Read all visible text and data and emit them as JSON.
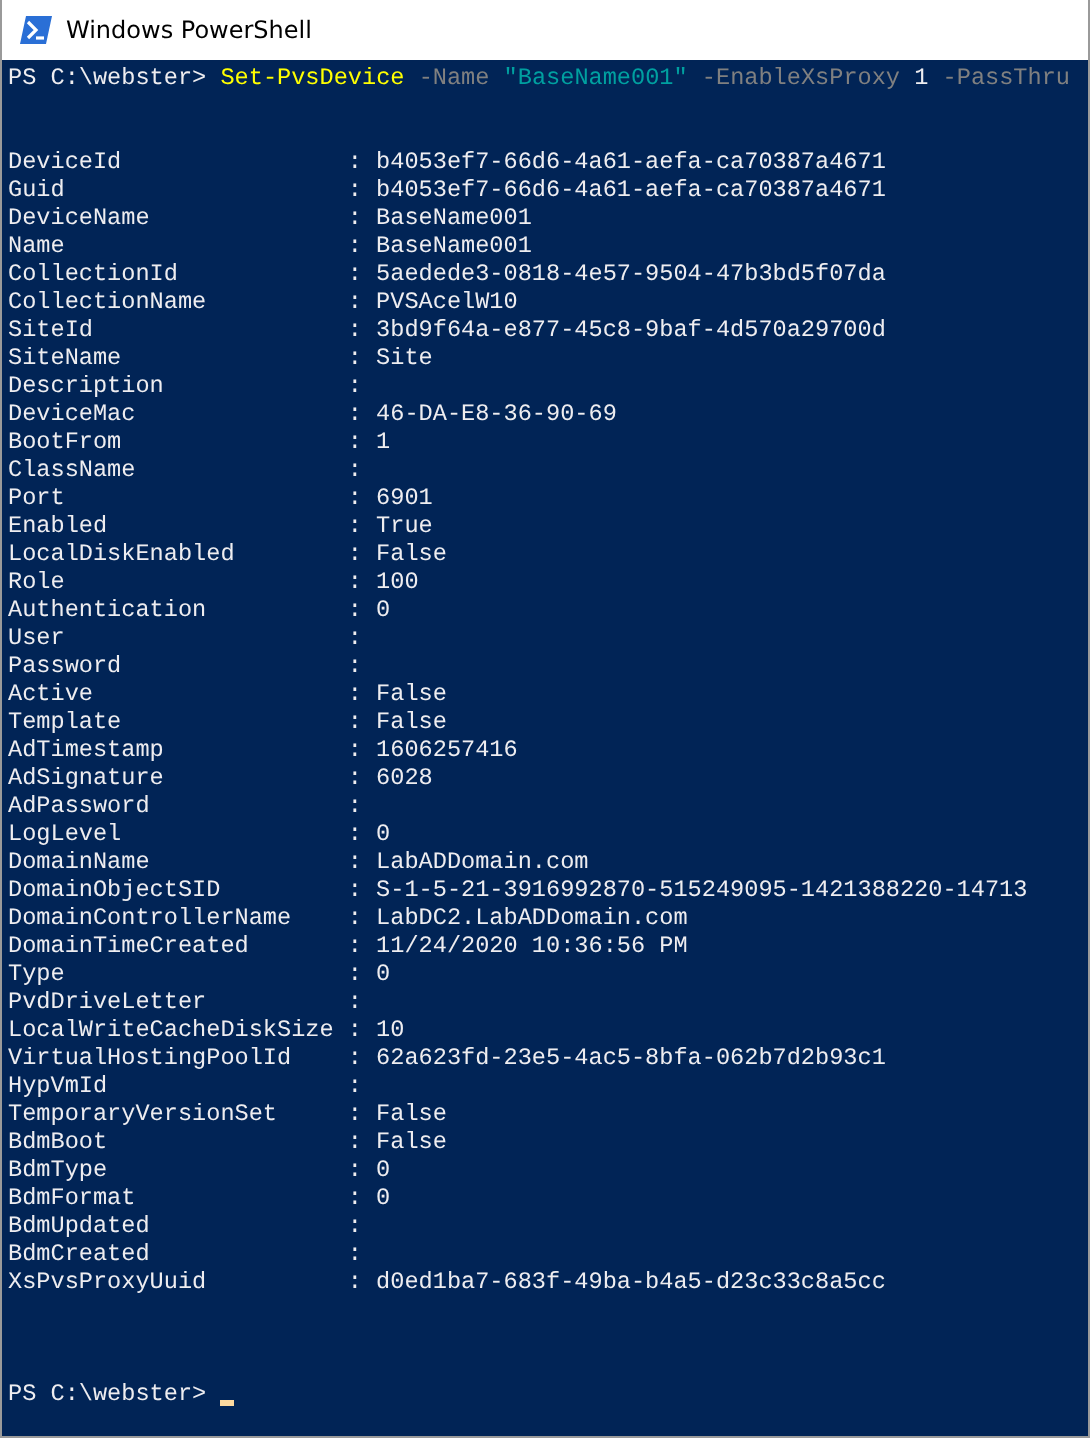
{
  "window": {
    "title": "Windows PowerShell"
  },
  "command": {
    "prompt": "PS C:\\webster>",
    "tokens": [
      {
        "kind": "cmdlet",
        "text": "Set-PvsDevice"
      },
      {
        "kind": "parameter",
        "text": "-Name"
      },
      {
        "kind": "string",
        "text": "\"BaseName001\""
      },
      {
        "kind": "parameter",
        "text": "-EnableXsProxy"
      },
      {
        "kind": "number",
        "text": "1"
      },
      {
        "kind": "parameter",
        "text": "-PassThru"
      }
    ]
  },
  "properties": [
    {
      "name": "DeviceId",
      "value": ": b4053ef7-66d6-4a61-aefa-ca70387a4671"
    },
    {
      "name": "Guid",
      "value": ": b4053ef7-66d6-4a61-aefa-ca70387a4671"
    },
    {
      "name": "DeviceName",
      "value": ": BaseName001"
    },
    {
      "name": "Name",
      "value": ": BaseName001"
    },
    {
      "name": "CollectionId",
      "value": ": 5aedede3-0818-4e57-9504-47b3bd5f07da"
    },
    {
      "name": "CollectionName",
      "value": ": PVSAcelW10"
    },
    {
      "name": "SiteId",
      "value": ": 3bd9f64a-e877-45c8-9baf-4d570a29700d"
    },
    {
      "name": "SiteName",
      "value": ": Site"
    },
    {
      "name": "Description",
      "value": ":"
    },
    {
      "name": "DeviceMac",
      "value": ": 46-DA-E8-36-90-69"
    },
    {
      "name": "BootFrom",
      "value": ": 1"
    },
    {
      "name": "ClassName",
      "value": ":"
    },
    {
      "name": "Port",
      "value": ": 6901"
    },
    {
      "name": "Enabled",
      "value": ": True"
    },
    {
      "name": "LocalDiskEnabled",
      "value": ": False"
    },
    {
      "name": "Role",
      "value": ": 100"
    },
    {
      "name": "Authentication",
      "value": ": 0"
    },
    {
      "name": "User",
      "value": ":"
    },
    {
      "name": "Password",
      "value": ":"
    },
    {
      "name": "Active",
      "value": ": False"
    },
    {
      "name": "Template",
      "value": ": False"
    },
    {
      "name": "AdTimestamp",
      "value": ": 1606257416"
    },
    {
      "name": "AdSignature",
      "value": ": 6028"
    },
    {
      "name": "AdPassword",
      "value": ":"
    },
    {
      "name": "LogLevel",
      "value": ": 0"
    },
    {
      "name": "DomainName",
      "value": ": LabADDomain.com"
    },
    {
      "name": "DomainObjectSID",
      "value": ": S-1-5-21-3916992870-515249095-1421388220-14713"
    },
    {
      "name": "DomainControllerName",
      "value": ": LabDC2.LabADDomain.com"
    },
    {
      "name": "DomainTimeCreated",
      "value": ": 11/24/2020 10:36:56 PM"
    },
    {
      "name": "Type",
      "value": ": 0"
    },
    {
      "name": "PvdDriveLetter",
      "value": ":"
    },
    {
      "name": "LocalWriteCacheDiskSize",
      "value": ": 10"
    },
    {
      "name": "VirtualHostingPoolId",
      "value": ": 62a623fd-23e5-4ac5-8bfa-062b7d2b93c1"
    },
    {
      "name": "HypVmId",
      "value": ":"
    },
    {
      "name": "TemporaryVersionSet",
      "value": ": False"
    },
    {
      "name": "BdmBoot",
      "value": ": False"
    },
    {
      "name": "BdmType",
      "value": ": 0"
    },
    {
      "name": "BdmFormat",
      "value": ": 0"
    },
    {
      "name": "BdmUpdated",
      "value": ":"
    },
    {
      "name": "BdmCreated",
      "value": ":"
    },
    {
      "name": "XsPvsProxyUuid",
      "value": ": d0ed1ba7-683f-49ba-b4a5-d23c33c8a5cc"
    }
  ],
  "final_prompt": {
    "prompt": "PS C:\\webster>"
  }
}
